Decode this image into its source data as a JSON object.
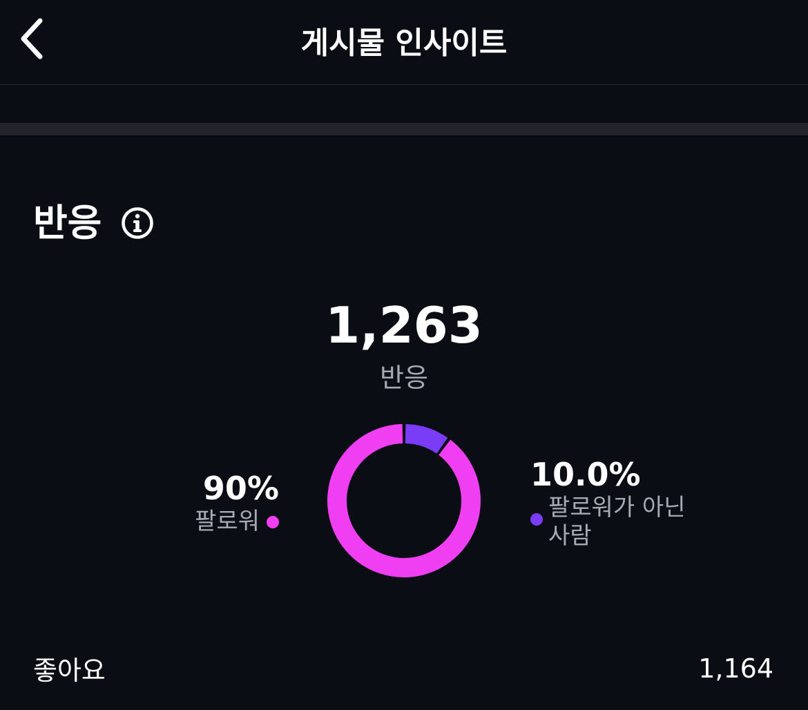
{
  "header": {
    "title": "게시물 인사이트",
    "back_icon": "chevron-left-icon"
  },
  "section": {
    "title": "반응",
    "info_icon": "info-icon"
  },
  "summary": {
    "total": "1,263",
    "total_label": "반응"
  },
  "breakdown": {
    "followers": {
      "percent": "90%",
      "label": "팔로워",
      "color": "#f03ef2",
      "fraction": 0.9
    },
    "non_followers": {
      "percent": "10.0%",
      "label": "팔로워가 아닌 사람",
      "color": "#7a3cf6",
      "fraction": 0.1
    }
  },
  "metrics": [
    {
      "label": "좋아요",
      "value": "1,164"
    }
  ]
}
